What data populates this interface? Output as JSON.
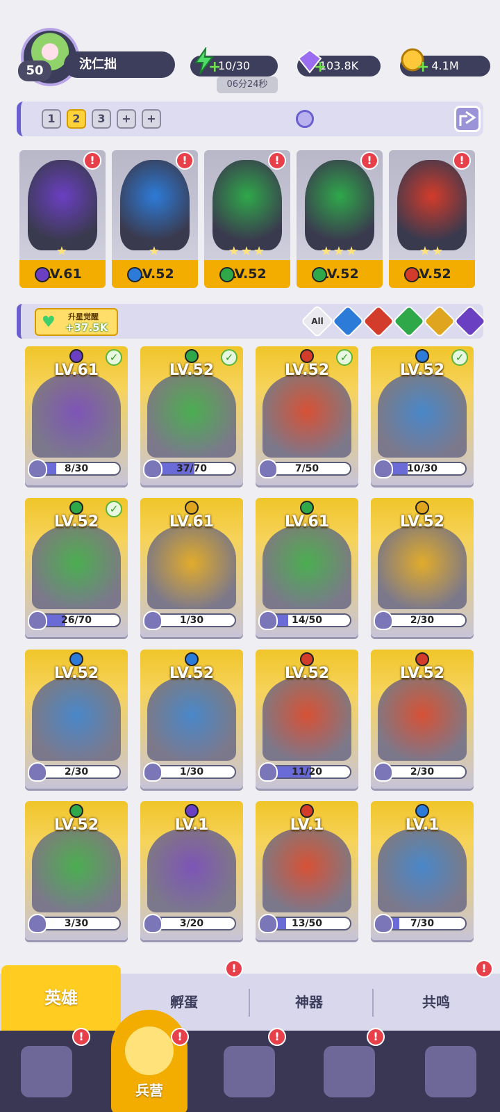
{
  "player": {
    "level": "50",
    "name": "沈仁拙"
  },
  "resources": {
    "energy": "10/30",
    "energy_timer": "06分24秒",
    "gems": "103.8K",
    "gold": "4.1M"
  },
  "team_tabs": [
    "1",
    "2",
    "3",
    "+",
    "+"
  ],
  "team": [
    {
      "level": "LV.61",
      "element": "dark",
      "color": "#6a3fc2",
      "stars": "★",
      "alert": "!"
    },
    {
      "level": "LV.52",
      "element": "water",
      "color": "#2d7bd8",
      "stars": "★",
      "alert": "!"
    },
    {
      "level": "LV.52",
      "element": "wind",
      "color": "#2fa84a",
      "stars": "★★★",
      "alert": "!"
    },
    {
      "level": "LV.52",
      "element": "wind",
      "color": "#2fa84a",
      "stars": "★★★",
      "alert": "!"
    },
    {
      "level": "LV.52",
      "element": "fire",
      "color": "#d33b2a",
      "stars": "★★",
      "alert": "!"
    }
  ],
  "bonus": {
    "title": "升星觉醒",
    "value": "+37.5K"
  },
  "filters": [
    "All",
    "water",
    "fire",
    "wind",
    "light",
    "dark"
  ],
  "filter_colors": {
    "water": "#2d7bd8",
    "fire": "#d33b2a",
    "wind": "#2fa84a",
    "light": "#e0a51e",
    "dark": "#6a3fc2"
  },
  "heroes": [
    {
      "level": "LV.61",
      "element": "dark",
      "shards": "8/30",
      "progress": 0.27,
      "check": true
    },
    {
      "level": "LV.52",
      "element": "wind",
      "shards": "37/70",
      "progress": 0.53,
      "check": true
    },
    {
      "level": "LV.52",
      "element": "fire",
      "shards": "7/50",
      "progress": 0.14,
      "check": true
    },
    {
      "level": "LV.52",
      "element": "water",
      "shards": "10/30",
      "progress": 0.33,
      "check": true
    },
    {
      "level": "LV.52",
      "element": "wind",
      "shards": "26/70",
      "progress": 0.37,
      "check": true
    },
    {
      "level": "LV.61",
      "element": "light",
      "shards": "1/30",
      "progress": 0.03,
      "check": false
    },
    {
      "level": "LV.61",
      "element": "wind",
      "shards": "14/50",
      "progress": 0.28,
      "check": false
    },
    {
      "level": "LV.52",
      "element": "light",
      "shards": "2/30",
      "progress": 0.07,
      "check": false
    },
    {
      "level": "LV.52",
      "element": "water",
      "shards": "2/30",
      "progress": 0.07,
      "check": false
    },
    {
      "level": "LV.52",
      "element": "water",
      "shards": "1/30",
      "progress": 0.03,
      "check": false
    },
    {
      "level": "LV.52",
      "element": "fire",
      "shards": "11/20",
      "progress": 0.55,
      "check": false
    },
    {
      "level": "LV.52",
      "element": "fire",
      "shards": "2/30",
      "progress": 0.07,
      "check": false
    },
    {
      "level": "LV.52",
      "element": "wind",
      "shards": "3/30",
      "progress": 0.1,
      "check": false
    },
    {
      "level": "LV.1",
      "element": "dark",
      "shards": "3/20",
      "progress": 0.15,
      "check": false
    },
    {
      "level": "LV.1",
      "element": "fire",
      "shards": "13/50",
      "progress": 0.26,
      "check": false
    },
    {
      "level": "LV.1",
      "element": "water",
      "shards": "7/30",
      "progress": 0.23,
      "check": false
    }
  ],
  "tabs": [
    {
      "label": "英雄",
      "selected": true
    },
    {
      "label": "孵蛋",
      "selected": false
    },
    {
      "label": "神器",
      "selected": false
    },
    {
      "label": "共鸣",
      "selected": false
    }
  ],
  "nav": {
    "items": [
      "cards-icon",
      "barracks-icon",
      "map-icon",
      "temple-icon",
      "mushroom-icon"
    ],
    "center_label": "兵营"
  },
  "alert_glyph": "!"
}
